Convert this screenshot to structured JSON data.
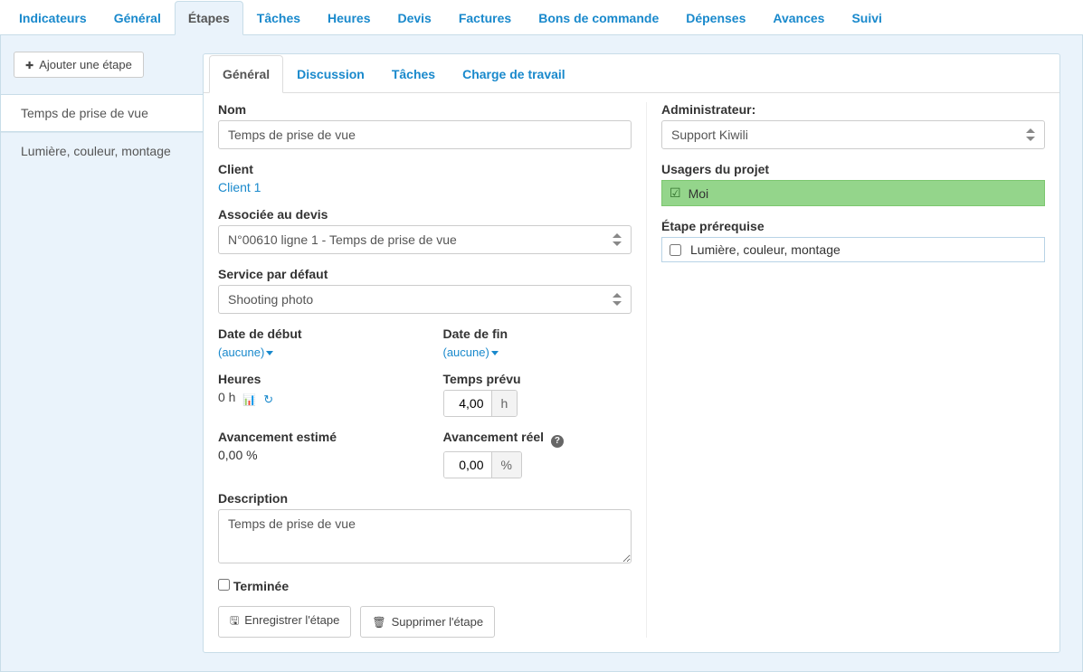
{
  "topTabs": {
    "indicateurs": "Indicateurs",
    "general": "Général",
    "etapes": "Étapes",
    "taches": "Tâches",
    "heures": "Heures",
    "devis": "Devis",
    "factures": "Factures",
    "bonsCommande": "Bons de commande",
    "depenses": "Dépenses",
    "avances": "Avances",
    "suivi": "Suivi"
  },
  "sidebar": {
    "addStep": "Ajouter une étape",
    "items": [
      {
        "label": "Temps de prise de vue"
      },
      {
        "label": "Lumière, couleur, montage"
      }
    ]
  },
  "subTabs": {
    "general": "Général",
    "discussion": "Discussion",
    "taches": "Tâches",
    "charge": "Charge de travail"
  },
  "form": {
    "nameLabel": "Nom",
    "nameValue": "Temps de prise de vue",
    "clientLabel": "Client",
    "clientLink": "Client 1",
    "quoteLabel": "Associée au devis",
    "quoteValue": "N°00610 ligne 1 - Temps de prise de vue",
    "serviceLabel": "Service par défaut",
    "serviceValue": "Shooting photo",
    "startLabel": "Date de début",
    "startValue": "(aucune)",
    "endLabel": "Date de fin",
    "endValue": "(aucune)",
    "hoursLabel": "Heures",
    "hoursValue": "0 h",
    "plannedLabel": "Temps prévu",
    "plannedValue": "4,00",
    "hoursUnit": "h",
    "estProgressLabel": "Avancement estimé",
    "estProgressValue": "0,00 %",
    "realProgressLabel": "Avancement réel",
    "realProgressValue": "0,00",
    "percentUnit": "%",
    "descLabel": "Description",
    "descValue": "Temps de prise de vue",
    "terminee": "Terminée",
    "saveBtn": "Enregistrer l'étape",
    "deleteBtn": "Supprimer l'étape"
  },
  "right": {
    "adminLabel": "Administrateur:",
    "adminValue": "Support Kiwili",
    "usersLabel": "Usagers du projet",
    "userMe": "Moi",
    "prereqLabel": "Étape prérequise",
    "prereqItem": "Lumière, couleur, montage"
  }
}
